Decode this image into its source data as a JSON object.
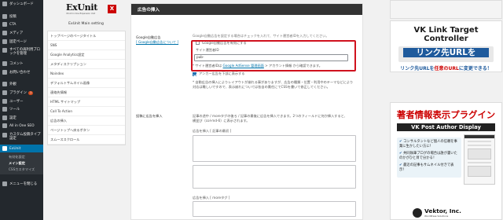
{
  "admin_menu": {
    "items": [
      {
        "label": "ダッシュボード"
      },
      {
        "label": "投稿"
      },
      {
        "label": "CTA"
      },
      {
        "label": "メディア"
      },
      {
        "label": "固定ページ"
      },
      {
        "label": "すべての再利用ブロックを管理"
      },
      {
        "label": "コメント"
      },
      {
        "label": "お問い合わせ"
      },
      {
        "label": "外観"
      },
      {
        "label": "プラグイン",
        "badge": "1"
      },
      {
        "label": "ユーザー"
      },
      {
        "label": "ツール"
      },
      {
        "label": "設定"
      },
      {
        "label": "All in One SEO"
      },
      {
        "label": "カスタム投稿タイプ設定"
      },
      {
        "label": "ExUnit"
      }
    ],
    "submenu": [
      "有効化設定",
      "メイン設定",
      "CSSカスタマイズ"
    ],
    "collapse_label": "メニューを閉じる"
  },
  "unit_nav": {
    "logo_word": "ExUnit",
    "logo_tagline": "VK All in One Expansion Unit",
    "title": "ExUnit Main setting",
    "items": [
      "トップページのページタイトル",
      "SNS",
      "Google Analytics設定",
      "メタディスクリプション",
      "Noindex",
      "デフォルトサムネイル画像",
      "連絡先情報",
      "HTML サイトマップ",
      "Call To Action",
      "広告の挿入",
      "ページトップへ戻るボタン",
      "スムーススクロール"
    ]
  },
  "main": {
    "header": "広告の挿入",
    "adsense": {
      "heading": "Google自動広告",
      "heading_link": "[ Google自動広告について ]",
      "description": "Google自動広告を設定する場合はチェックを入れて、サイト運営者IDを入力してください。",
      "checkbox_label": "Google自動広告を有効にする",
      "pubid_label": "サイト運営者ID",
      "pubid_value": "pub-",
      "note_prefix": "* サイト運営者IDは",
      "note_link": "Google AdSense 管理画面",
      "note_suffix": "> アカウント情報 から確認できます。",
      "anchor_label": "アンカー広告を下部に表示する",
      "anchor_checked": true,
      "notice": "* 自動広告の挿入によりレイアウトが崩れる事がありますが、広告の種類・位置・利用中のテーマなどにより対応は難しいですので、表示崩れについては各自の責任にてCSSを書いて修正してください。"
    },
    "insert": {
      "heading": "投稿に広告を挿入",
      "description": "記事の途中 / moreタグの後ろ / 記事の最後に広告を挿入できます。2つのフィールドに何か挿入すると、横並び（col-md-6）に表示されます。",
      "field1_label": "広告を挿入 [ 記事の最初 ]",
      "field2_label": "広告を挿入 [ moreタグ ]"
    }
  },
  "ads": {
    "ad2": {
      "title": "VK Link Target Controller",
      "line1": "リンク先URLを",
      "line2_prefix": "リンク先URLを",
      "line2_em": "任意のURL",
      "line2_suffix": "に変更できる！"
    },
    "ad3": {
      "heading": "著者情報表示プラグイン",
      "subheading": "VK Post Author Display",
      "features": [
        {
          "title": "コンサルタントなど個人の信頼を事業に生かしたい方に！"
        },
        {
          "title": "共同執筆ブログの場合は誰が書いたのかがひと目で分かる！"
        },
        {
          "title": "最近の記事もサムネイル付きで表示！"
        }
      ],
      "brand": "Vektor, Inc.",
      "brand_sub": "WordPress Solutions"
    }
  },
  "colors": {
    "admin_bg": "#23282d",
    "admin_current": "#0073aa",
    "highlight_border": "#d0121e",
    "link": "#0073aa",
    "brand_red": "#cc0000",
    "brand_blue": "#1e5a9c"
  }
}
